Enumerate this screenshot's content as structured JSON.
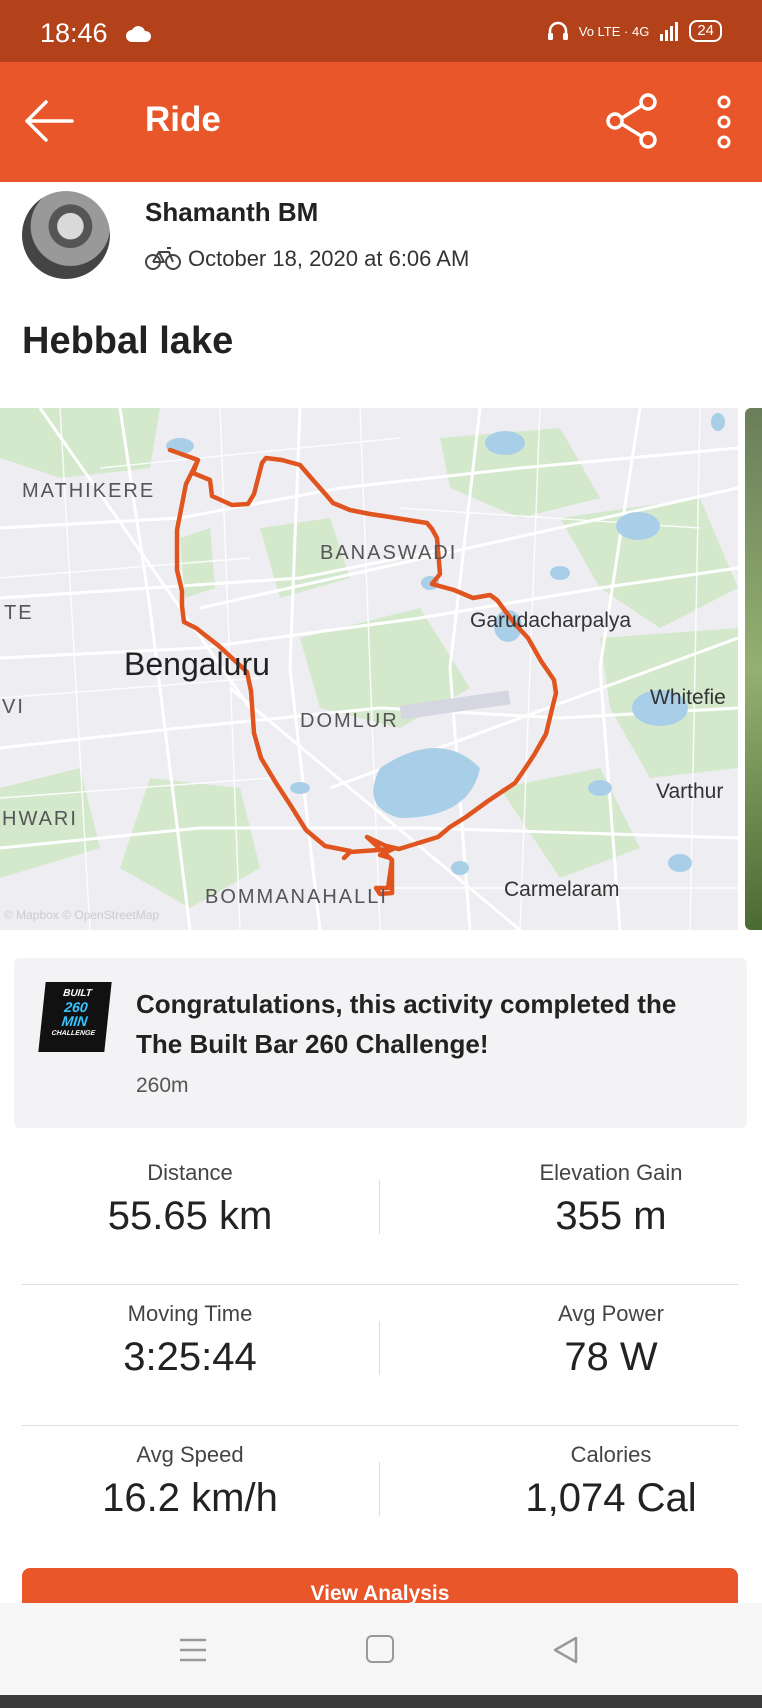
{
  "status_bar": {
    "time": "18:46",
    "network": "Vo LTE · 4G",
    "battery": "24"
  },
  "app_bar": {
    "title": "Ride"
  },
  "athlete": {
    "name": "Shamanth BM",
    "date": "October 18, 2020 at 6:06 AM"
  },
  "activity": {
    "title": "Hebbal lake"
  },
  "map": {
    "route_color": "#e0551f",
    "labels": {
      "mathikere": "MATHIKERE",
      "banaswadi": "BANASWADI",
      "te": "TE",
      "garudacharpalya": "Garudacharpalya",
      "bengaluru": "Bengaluru",
      "whitefield": "Whitefie",
      "vi": "VI",
      "domlur": "DOMLUR",
      "varthur": "Varthur",
      "hwari": "HWARI",
      "carmelaram": "Carmelaram",
      "bommanahalli": "BOMMANAHALLI"
    },
    "attribution": "© Mapbox © OpenStreetMap"
  },
  "challenge": {
    "logo_line1": "BUILT",
    "logo_line2": "260",
    "logo_line3": "MIN",
    "logo_line4": "CHALLENGE",
    "message": "Congratulations, this activity completed the The Built Bar 260 Challenge!",
    "subtitle": "260m"
  },
  "stats": {
    "distance": {
      "label": "Distance",
      "value": "55.65 km"
    },
    "elevation": {
      "label": "Elevation Gain",
      "value": "355 m"
    },
    "moving_time": {
      "label": "Moving Time",
      "value": "3:25:44"
    },
    "avg_power": {
      "label": "Avg Power",
      "value": "78 W"
    },
    "avg_speed": {
      "label": "Avg Speed",
      "value": "16.2 km/h"
    },
    "calories": {
      "label": "Calories",
      "value": "1,074 Cal"
    }
  },
  "actions": {
    "view_analysis": "View Analysis"
  },
  "colors": {
    "brand_orange": "#e8562a",
    "status_bar": "#b3421b"
  }
}
